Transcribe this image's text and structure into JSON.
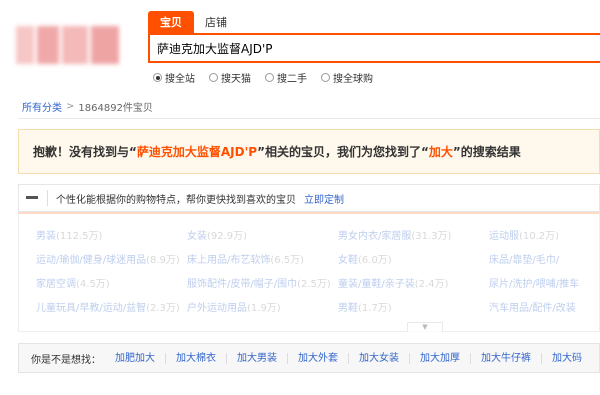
{
  "search": {
    "tabs": [
      "宝贝",
      "店铺"
    ],
    "query": "萨迪克加大监督AJD'P",
    "scopes": [
      {
        "label": "搜全站",
        "selected": true
      },
      {
        "label": "搜天猫",
        "selected": false
      },
      {
        "label": "搜二手",
        "selected": false
      },
      {
        "label": "搜全球购",
        "selected": false
      }
    ]
  },
  "breadcrumb": {
    "all": "所有分类",
    "sep": ">",
    "count": "1864892件宝贝"
  },
  "notice": {
    "prefix": "抱歉！没有找到与“",
    "keyword": "萨迪克加大监督AJD'P",
    "middle": "”相关的宝贝，我们为您找到了“",
    "found": "加大",
    "suffix": "”的搜索结果"
  },
  "personalize": {
    "text": "个性化能根据你的购物特点，帮你更快找到喜欢的宝贝",
    "link": "立即定制"
  },
  "categories": [
    {
      "name": "男装",
      "count": "(112.5万)"
    },
    {
      "name": "女装",
      "count": "(92.9万)"
    },
    {
      "name": "男女内衣/家居服",
      "count": "(31.3万)"
    },
    {
      "name": "运动服",
      "count": "(10.2万)"
    },
    {
      "name": "运动/瑜伽/健身/球迷用品",
      "count": "(8.9万)"
    },
    {
      "name": "床上用品/布艺软饰",
      "count": "(6.5万)"
    },
    {
      "name": "女鞋",
      "count": "(6.0万)"
    },
    {
      "name": "床品/靠垫/毛巾/",
      "count": ""
    },
    {
      "name": "家居空调",
      "count": "(4.5万)"
    },
    {
      "name": "服饰配件/皮带/帽子/围巾",
      "count": "(2.5万)"
    },
    {
      "name": "童装/童鞋/亲子装",
      "count": "(2.4万)"
    },
    {
      "name": "尿片/洗护/喂哺/推车",
      "count": ""
    },
    {
      "name": "儿童玩具/早教/运动/益智",
      "count": "(2.3万)"
    },
    {
      "name": "户外运动用品",
      "count": "(1.9万)"
    },
    {
      "name": "男鞋",
      "count": "(1.7万)"
    },
    {
      "name": "汽车用品/配件/改装",
      "count": ""
    }
  ],
  "related": {
    "label": "你是不是想找：",
    "items": [
      "加肥加大",
      "加大棉衣",
      "加大男装",
      "加大外套",
      "加大女装",
      "加大加厚",
      "加大牛仔裤",
      "加大码"
    ]
  },
  "colors": {
    "accent": "#ff5000",
    "link": "#3366cc"
  }
}
